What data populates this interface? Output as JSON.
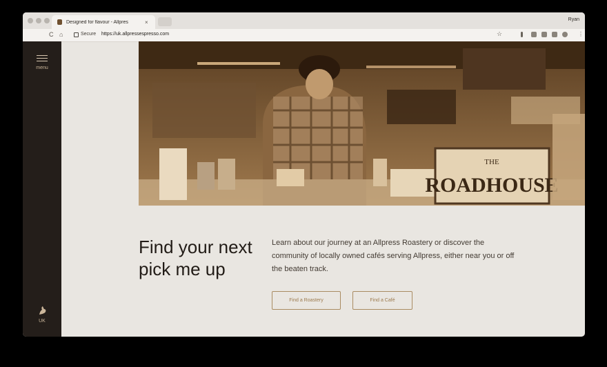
{
  "browser": {
    "tab_title": "Designed for flavour - Allpres",
    "tab_close": "×",
    "profile_name": "Ryan",
    "secure_label": "Secure",
    "url": "https://uk.allpressespresso.com",
    "bookmark_icon": "☆",
    "menu_icon": "⋮",
    "reload_icon": "C",
    "home_icon": "⌂"
  },
  "sidebar": {
    "menu_label": "menu",
    "region_label": "UK"
  },
  "hero": {
    "sign_text": "ROADHOUSE",
    "sign_subtext": "THE"
  },
  "content": {
    "headline": "Find your next pick me up",
    "description": "Learn about our journey at an Allpress Roastery or discover the community of locally owned cafés serving Allpress, either near you or off the beaten track.",
    "button_roastery": "Find a Roastery",
    "button_cafe": "Find a Café"
  },
  "colors": {
    "sidebar_bg": "#241e1a",
    "page_bg": "#e9e6e1",
    "accent": "#a98b61",
    "text": "#221c17"
  }
}
